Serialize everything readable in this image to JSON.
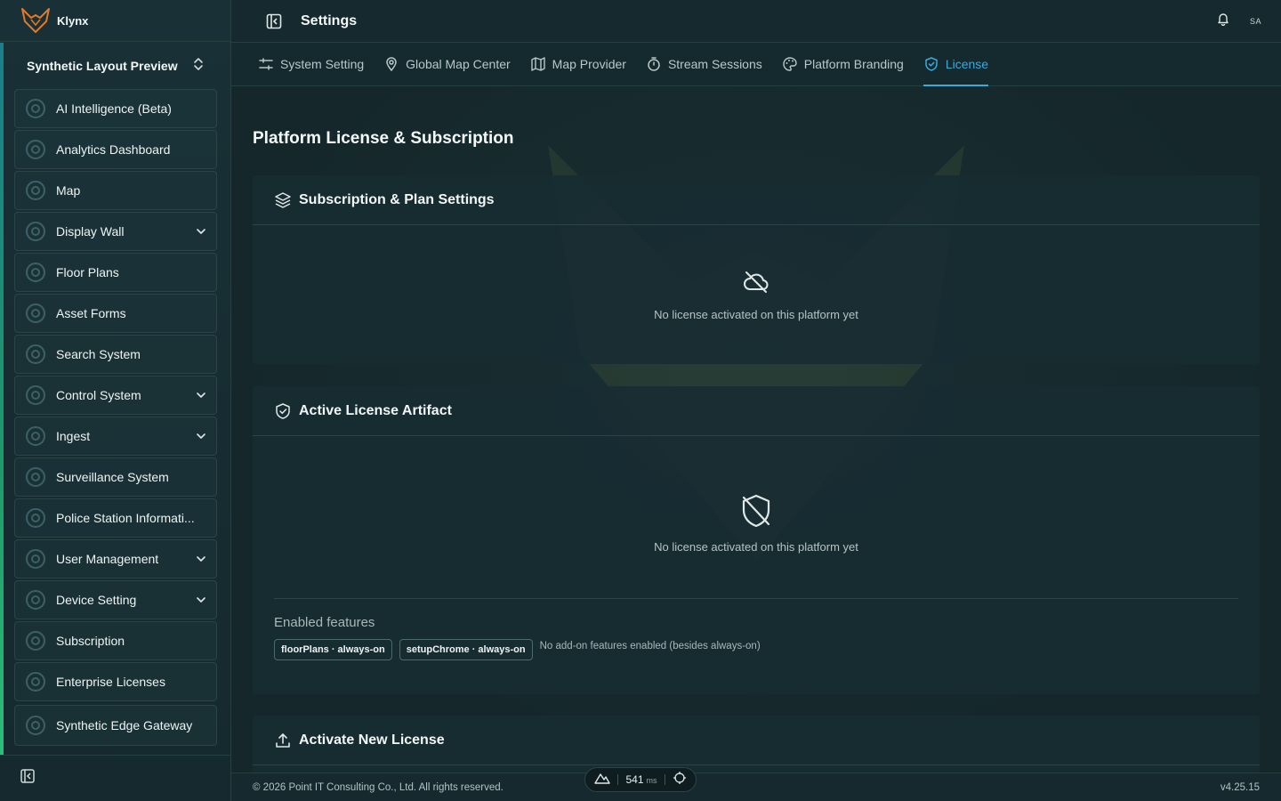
{
  "app": {
    "name": "Klynx"
  },
  "workspace": {
    "name": "Synthetic Layout Preview"
  },
  "sidebar": {
    "items": [
      {
        "label": "AI Intelligence (Beta)",
        "icon": "ai-icon",
        "expandable": false
      },
      {
        "label": "Analytics Dashboard",
        "icon": "chart-icon",
        "expandable": false
      },
      {
        "label": "Map",
        "icon": "map-pin-icon",
        "expandable": false
      },
      {
        "label": "Display Wall",
        "icon": "layout-icon",
        "expandable": true
      },
      {
        "label": "Floor Plans",
        "icon": "layers-icon",
        "expandable": false
      },
      {
        "label": "Asset Forms",
        "icon": "clipboard-icon",
        "expandable": false
      },
      {
        "label": "Search System",
        "icon": "scan-icon",
        "expandable": false
      },
      {
        "label": "Control System",
        "icon": "cpu-icon",
        "expandable": true
      },
      {
        "label": "Ingest",
        "icon": "inbox-icon",
        "expandable": true
      },
      {
        "label": "Surveillance System",
        "icon": "users-icon",
        "expandable": false
      },
      {
        "label": "Police Station Informati...",
        "icon": "eye-icon",
        "expandable": false
      },
      {
        "label": "User Management",
        "icon": "user-group-icon",
        "expandable": true
      },
      {
        "label": "Device Setting",
        "icon": "gear-icon",
        "expandable": true
      },
      {
        "label": "Subscription",
        "icon": "credit-card-icon",
        "expandable": false
      },
      {
        "label": "Enterprise Licenses",
        "icon": "license-icon",
        "expandable": false
      },
      {
        "label": "Synthetic Edge Gateway",
        "icon": "gateway-icon",
        "expandable": false
      }
    ]
  },
  "header": {
    "title": "Settings",
    "avatar": "SA"
  },
  "tabs": [
    {
      "label": "System Setting",
      "icon": "sliders-icon",
      "active": false
    },
    {
      "label": "Global Map Center",
      "icon": "map-pin-icon",
      "active": false
    },
    {
      "label": "Map Provider",
      "icon": "map-icon",
      "active": false
    },
    {
      "label": "Stream Sessions",
      "icon": "timer-icon",
      "active": false
    },
    {
      "label": "Platform Branding",
      "icon": "palette-icon",
      "active": false
    },
    {
      "label": "License",
      "icon": "shield-check-icon",
      "active": true
    }
  ],
  "main": {
    "title": "Platform License & Subscription",
    "subscription": {
      "title": "Subscription & Plan Settings",
      "empty_text": "No license activated on this platform yet"
    },
    "artifact": {
      "title": "Active License Artifact",
      "empty_text": "No license activated on this platform yet",
      "features_label": "Enabled features",
      "chips": [
        "floorPlans · always-on",
        "setupChrome · always-on"
      ],
      "chips_note": "No add-on features enabled (besides always-on)"
    },
    "activate": {
      "title": "Activate New License"
    }
  },
  "footer": {
    "copyright": "© 2026 Point IT Consulting Co., Ltd. All rights reserved.",
    "version": "v4.25.15"
  },
  "devbar": {
    "ms_value": "541",
    "ms_unit": "ms"
  },
  "colors": {
    "accent": "#3fa8d8",
    "background": "#13252a",
    "teal": "#1e9a6a"
  }
}
